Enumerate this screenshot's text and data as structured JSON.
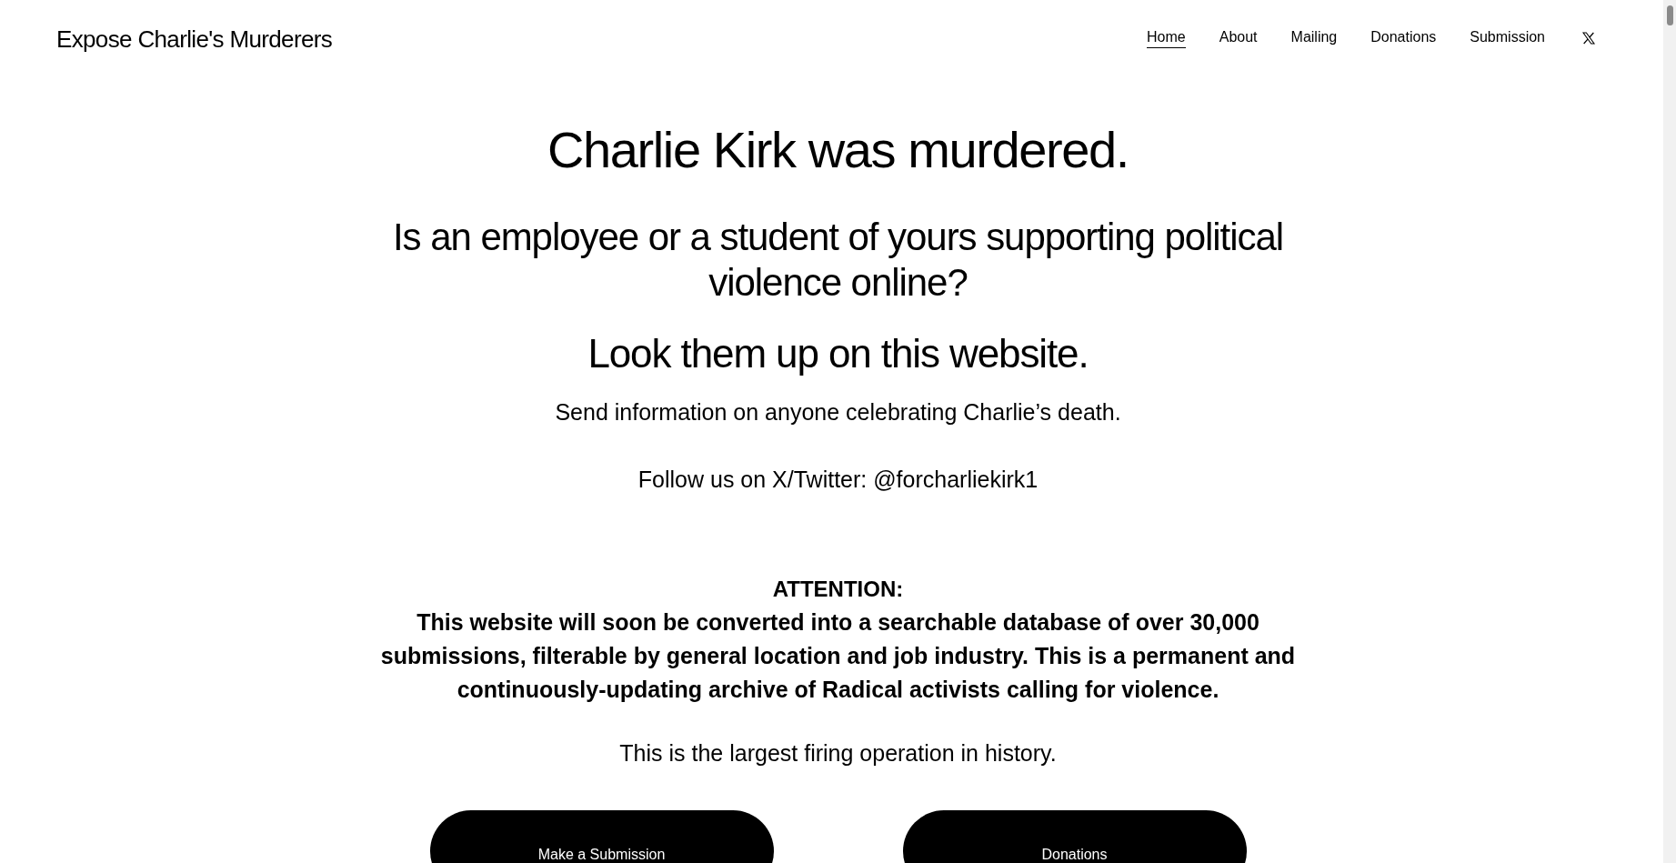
{
  "site_title": "Expose Charlie's Murderers",
  "nav": [
    {
      "label": "Home",
      "selected": true
    },
    {
      "label": "About",
      "selected": false
    },
    {
      "label": "Mailing",
      "selected": false
    },
    {
      "label": "Donations",
      "selected": false
    },
    {
      "label": "Submission",
      "selected": false
    }
  ],
  "headline": "Charlie Kirk was murdered.",
  "subheadline": "Is an employee or a student of yours supporting political violence online?",
  "callout": "Look them up on this website.",
  "paragraphs": [
    "Send information on anyone celebrating Charlie’s death.",
    "Follow us on X/Twitter: @forcharliekirk1"
  ],
  "attention": {
    "heading": "ATTENTION:",
    "body": "This website will soon be converted into a searchable database of over 30,000 submissions, filterable by general location and job industry. This is a permanent and continuously-updating archive of Radical activists calling for violence."
  },
  "closing": "This is the largest firing operation in history.",
  "buttons": [
    "Make a Submission",
    "Donations"
  ]
}
